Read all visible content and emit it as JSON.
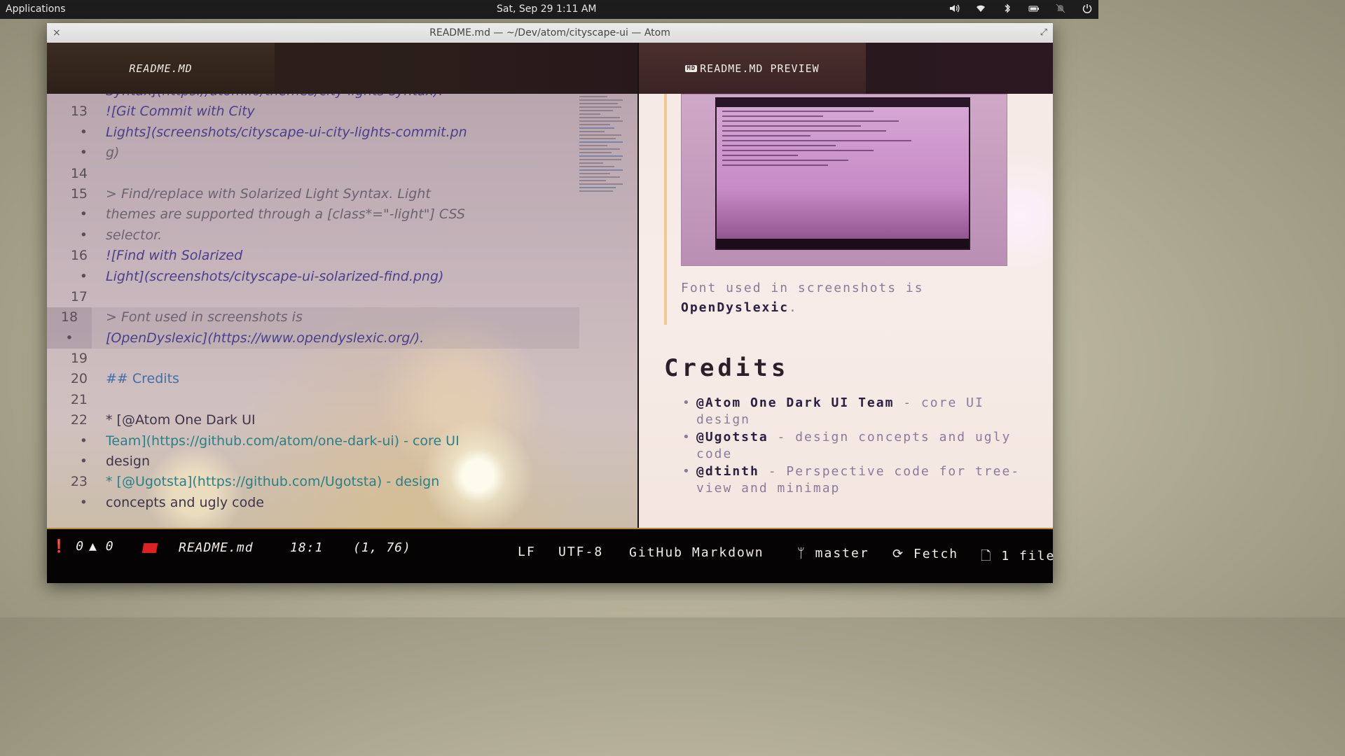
{
  "topbar": {
    "applications": "Applications",
    "clock": "Sat, Sep 29   1:11 AM",
    "tray_icons": [
      "volume-icon",
      "wifi-icon",
      "bluetooth-icon",
      "battery-icon",
      "notifications-icon",
      "power-icon"
    ]
  },
  "window": {
    "title": "README.md — ~/Dev/atom/cityscape-ui — Atom",
    "close": "×",
    "maximize": "⤢"
  },
  "tabs": {
    "left": "README.MD",
    "right_badge": "MD",
    "right": "README.MD PREVIEW"
  },
  "editor": {
    "rows": [
      {
        "n": "•",
        "t": "Syntax](https://atom.io/themes/city-lights-syntax)."
      },
      {
        "n": "13",
        "t": "![Git Commit with City"
      },
      {
        "n": "•",
        "t": "Lights](screenshots/cityscape-ui-city-lights-commit.pn"
      },
      {
        "n": "•",
        "t": "g)"
      },
      {
        "n": "14",
        "t": ""
      },
      {
        "n": "15",
        "t": "> Find/replace with Solarized Light Syntax. Light"
      },
      {
        "n": "•",
        "t": "themes are supported through a [class*=\"-light\"] CSS"
      },
      {
        "n": "•",
        "t": "selector."
      },
      {
        "n": "16",
        "t": "![Find with Solarized"
      },
      {
        "n": "•",
        "t": "Light](screenshots/cityscape-ui-solarized-find.png)"
      },
      {
        "n": "17",
        "t": ""
      },
      {
        "n": "18",
        "t": "> Font used in screenshots is"
      },
      {
        "n": "•",
        "t": "[OpenDyslexic](https://www.opendyslexic.org/)."
      },
      {
        "n": "19",
        "t": ""
      },
      {
        "n": "20",
        "t": "## Credits"
      },
      {
        "n": "21",
        "t": ""
      },
      {
        "n": "22",
        "t": "* [@Atom One Dark UI"
      },
      {
        "n": "•",
        "t": "Team](https://github.com/atom/one-dark-ui) - core UI"
      },
      {
        "n": "•",
        "t": "design"
      },
      {
        "n": "23",
        "t": "* [@Ugotsta](https://github.com/Ugotsta) - design"
      },
      {
        "n": "•",
        "t": "concepts and ugly code"
      }
    ]
  },
  "preview": {
    "font_prefix": "Font used in screenshots is",
    "font_name": "OpenDyslexic",
    "font_suffix": ".",
    "credits_heading": "Credits",
    "credits": [
      {
        "name": "@Atom One Dark UI Team",
        "rest": " - core UI design"
      },
      {
        "name": "@Ugotsta",
        "rest": " - design concepts and ugly code"
      },
      {
        "name": "@dtinth",
        "rest": " - Perspective code for tree-view and minimap"
      }
    ]
  },
  "statusbar": {
    "errors": "0",
    "warnings": "0",
    "file": "README.md",
    "cursor": "18:1",
    "selection": "(1, 76)",
    "line_ending": "LF",
    "encoding": "UTF-8",
    "grammar": "GitHub Markdown",
    "branch": "master",
    "fetch": "Fetch",
    "files": "1 file"
  }
}
